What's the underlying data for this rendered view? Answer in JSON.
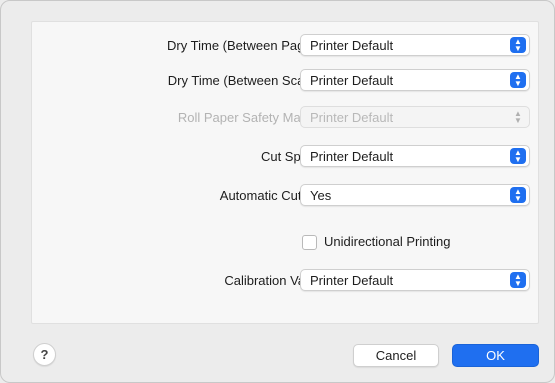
{
  "settings": {
    "rows": [
      {
        "label": "Dry Time (Between Pages):",
        "value": "Printer Default",
        "enabled": true
      },
      {
        "label": "Dry Time (Between Scans):",
        "value": "Printer Default",
        "enabled": true
      },
      {
        "label": "Roll Paper Safety Margin:",
        "value": "Printer Default",
        "enabled": false
      },
      {
        "label": "Cut Speed:",
        "value": "Printer Default",
        "enabled": true
      },
      {
        "label": "Automatic Cutting:",
        "value": "Yes",
        "enabled": true
      }
    ],
    "unidirectional_printing": {
      "label": "Unidirectional Printing",
      "checked": false
    },
    "calibration": {
      "label": "Calibration Value:",
      "value": "Printer Default",
      "enabled": true
    }
  },
  "footer": {
    "help_label": "?",
    "cancel_label": "Cancel",
    "ok_label": "OK"
  },
  "colors": {
    "accent": "#1f6ff0",
    "background": "#ececec",
    "panel": "#f7f7f7"
  },
  "icons": {
    "popup_arrows": "up-down-chevron-icon",
    "help": "question-mark-icon"
  }
}
